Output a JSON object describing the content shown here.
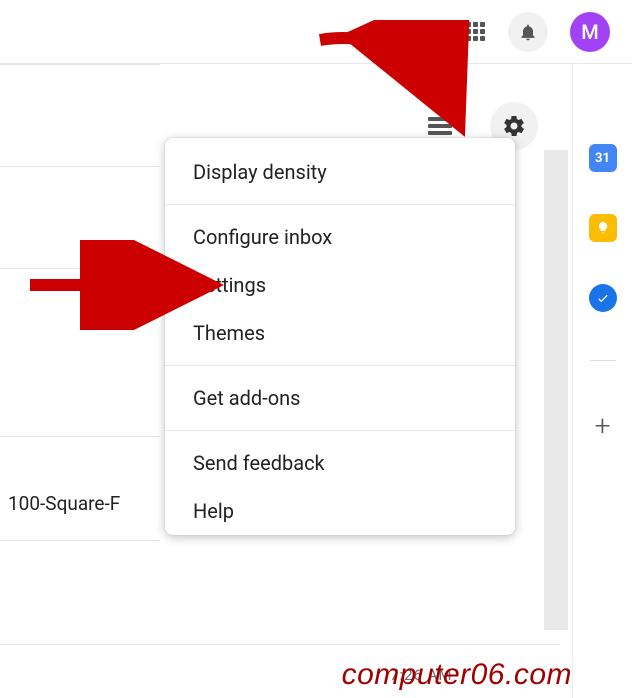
{
  "header": {
    "avatar_initial": "M"
  },
  "dropdown": {
    "items": [
      {
        "label": "Display density",
        "group": 1
      },
      {
        "label": "Configure inbox",
        "group": 2
      },
      {
        "label": "Settings",
        "group": 2
      },
      {
        "label": "Themes",
        "group": 2
      },
      {
        "label": "Get add-ons",
        "group": 3
      },
      {
        "label": "Send feedback",
        "group": 4
      },
      {
        "label": "Help",
        "group": 4
      }
    ]
  },
  "rows": {
    "visible_text": "100-Square-F"
  },
  "sidepanel": {
    "calendar_day": "31"
  },
  "partial_time": "7:26 AM",
  "watermark": "computer06.com"
}
